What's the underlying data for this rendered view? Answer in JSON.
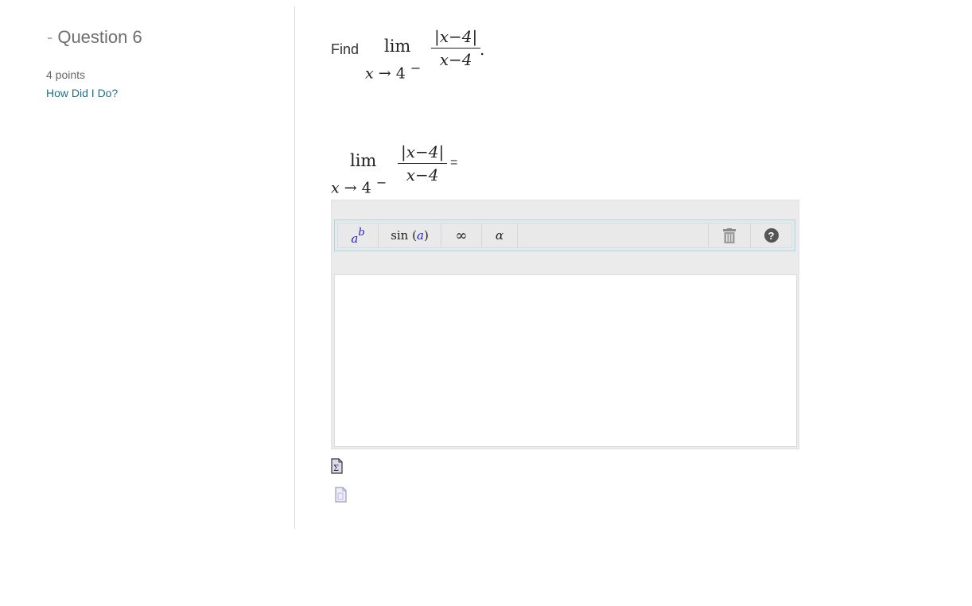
{
  "question": {
    "dash": "-",
    "title": "Question 6",
    "points": "4 points",
    "help_link": "How Did I Do?"
  },
  "prompt": {
    "find_label": "Find",
    "lim_word": "lim",
    "lim_sub_var": "x",
    "lim_sub_arrow": "→",
    "lim_sub_value": "4",
    "lim_sub_side": "−",
    "numerator": "|x−4|",
    "denominator": "x−4",
    "period": "."
  },
  "answer": {
    "lim_word": "lim",
    "lim_sub_var": "x",
    "lim_sub_arrow": "→",
    "lim_sub_value": "4",
    "lim_sub_side": "−",
    "numerator": "|x−4|",
    "denominator": "x−4",
    "equals": "="
  },
  "toolbar": {
    "power_base": "a",
    "power_exp": "b",
    "sin_fn": "sin",
    "sin_open": "(",
    "sin_arg": "a",
    "sin_close": ")",
    "infinity": "∞",
    "alpha": "α",
    "help": "?"
  },
  "icons": {
    "toolbar_trash": "trash-icon",
    "toolbar_help": "help-circle-icon",
    "equation_doc": "sigma-document-icon",
    "preview_doc": "document-icon"
  }
}
